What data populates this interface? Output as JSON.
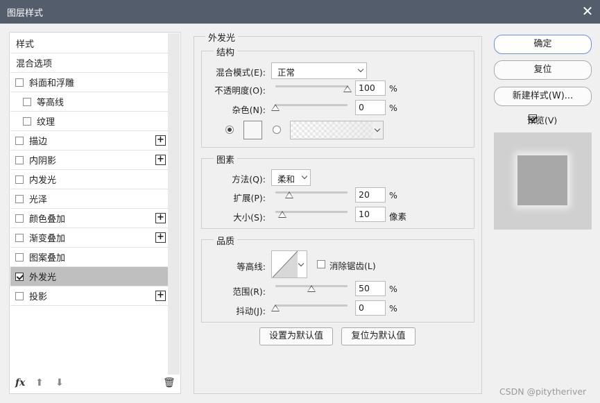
{
  "window": {
    "title": "图层样式",
    "close_icon": "close-icon"
  },
  "styles_list": {
    "header": "样式",
    "blend_options": "混合选项",
    "items": [
      {
        "label": "斜面和浮雕",
        "checked": false,
        "plus": false,
        "indent": false
      },
      {
        "label": "等高线",
        "checked": false,
        "plus": false,
        "indent": true
      },
      {
        "label": "纹理",
        "checked": false,
        "plus": false,
        "indent": true
      },
      {
        "label": "描边",
        "checked": false,
        "plus": true,
        "indent": false
      },
      {
        "label": "内阴影",
        "checked": false,
        "plus": true,
        "indent": false
      },
      {
        "label": "内发光",
        "checked": false,
        "plus": false,
        "indent": false
      },
      {
        "label": "光泽",
        "checked": false,
        "plus": false,
        "indent": false
      },
      {
        "label": "颜色叠加",
        "checked": false,
        "plus": true,
        "indent": false
      },
      {
        "label": "渐变叠加",
        "checked": false,
        "plus": true,
        "indent": false
      },
      {
        "label": "图案叠加",
        "checked": false,
        "plus": false,
        "indent": false
      },
      {
        "label": "外发光",
        "checked": true,
        "plus": false,
        "indent": false,
        "active": true
      },
      {
        "label": "投影",
        "checked": false,
        "plus": true,
        "indent": false
      }
    ],
    "footer": {
      "fx": "fx",
      "fx_icon": "fx-icon",
      "up_icon": "arrow-up-icon",
      "down_icon": "arrow-down-icon",
      "trash_icon": "trash-icon"
    }
  },
  "outer_glow": {
    "title": "外发光",
    "structure": {
      "title": "结构",
      "blend_mode_label": "混合模式(E):",
      "blend_mode_value": "正常",
      "opacity_label": "不透明度(O):",
      "opacity_value": "100",
      "opacity_unit": "%",
      "noise_label": "杂色(N):",
      "noise_value": "0",
      "noise_unit": "%"
    },
    "elements": {
      "title": "图素",
      "technique_label": "方法(Q):",
      "technique_value": "柔和",
      "spread_label": "扩展(P):",
      "spread_value": "20",
      "spread_unit": "%",
      "size_label": "大小(S):",
      "size_value": "10",
      "size_unit": "像素"
    },
    "quality": {
      "title": "品质",
      "contour_label": "等高线:",
      "antialias_label": "消除锯齿(L)",
      "range_label": "范围(R):",
      "range_value": "50",
      "range_unit": "%",
      "jitter_label": "抖动(J):",
      "jitter_value": "0",
      "jitter_unit": "%"
    },
    "make_default": "设置为默认值",
    "reset_default": "复位为默认值"
  },
  "right": {
    "ok": "确定",
    "reset": "复位",
    "new_style": "新建样式(W)...",
    "preview_label": "预览(V)"
  },
  "watermark": "CSDN @pitytheriver",
  "colors": {
    "titlebar": "#535d6b",
    "accent": "#6c8fd6",
    "active_row": "#bfbfbf"
  }
}
